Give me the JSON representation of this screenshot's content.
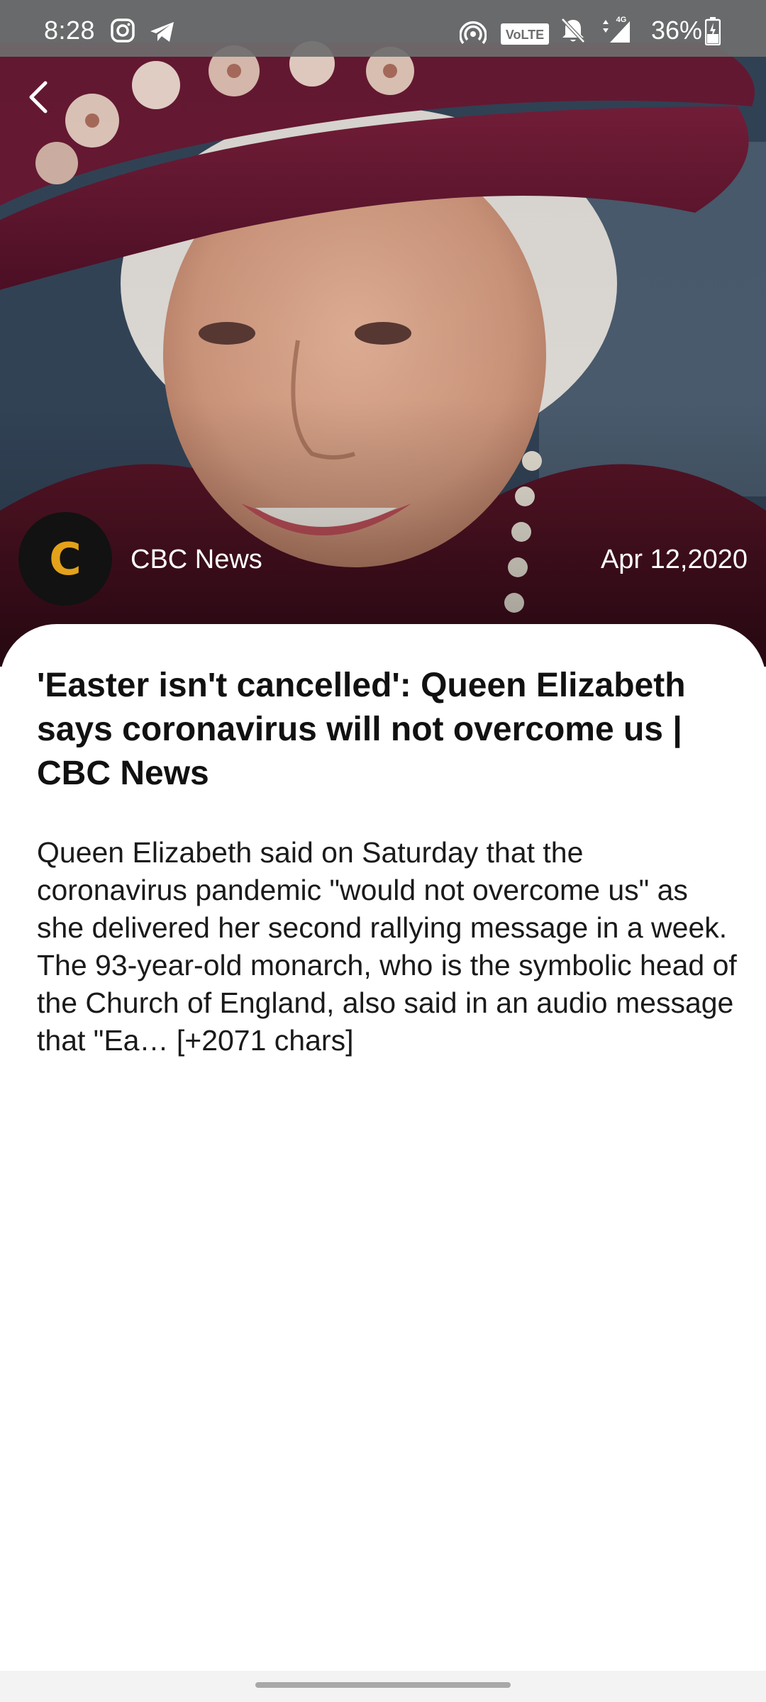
{
  "status_bar": {
    "time": "8:28",
    "battery": "36%",
    "icons": [
      "instagram-icon",
      "telegram-icon",
      "hotspot-icon",
      "volte-icon",
      "mute-icon",
      "signal-4g-icon",
      "battery-icon"
    ],
    "volte_label": "VoLTE",
    "network_label": "4G"
  },
  "header": {
    "back_icon": "chevron-left-icon"
  },
  "source": {
    "initial": "C",
    "name": "CBC News",
    "date": "Apr 12,2020",
    "avatar_color": "#e3a21a"
  },
  "article": {
    "title": "'Easter isn't cancelled': Queen Elizabeth says coronavirus will not overcome us | CBC News",
    "body": "Queen Elizabeth said on Saturday that the coronavirus pandemic \"would not overcome us\" as she delivered her second rallying message in a week.\nThe 93-year-old monarch, who is the symbolic head of the Church of England, also said in an audio message that  \"Ea… [+2071 chars]"
  }
}
